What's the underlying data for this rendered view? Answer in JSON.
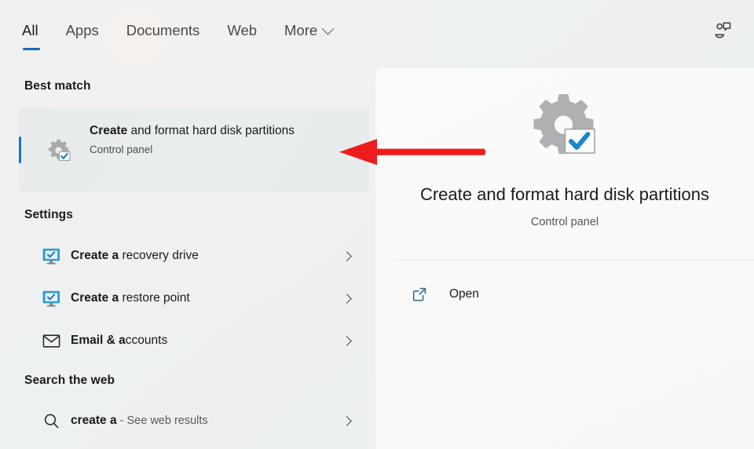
{
  "tabbar": {
    "tabs": [
      {
        "label": "All",
        "active": true
      },
      {
        "label": "Apps",
        "active": false
      },
      {
        "label": "Documents",
        "active": false
      },
      {
        "label": "Web",
        "active": false
      },
      {
        "label": "More",
        "active": false,
        "has_chevron": true
      }
    ],
    "feedback_icon": "feedback-person-speech-bubble-icon"
  },
  "left_panel": {
    "best_match": {
      "heading": "Best match",
      "title_bold": "Create",
      "title_rest": " and format hard disk partitions",
      "subtitle": "Control panel",
      "icon": "gear-with-checkbox-icon",
      "accent_color": "#1a6fc4",
      "selected": true
    },
    "settings": {
      "heading": "Settings",
      "items": [
        {
          "label_bold": "Create a",
          "label_rest": " recovery drive",
          "icon": "monitor-check-icon",
          "chevron": "chevron-right-icon"
        },
        {
          "label_bold": "Create a",
          "label_rest": " restore point",
          "icon": "monitor-check-icon",
          "chevron": "chevron-right-icon"
        },
        {
          "label_bold": "Email & a",
          "label_rest": "ccounts",
          "icon": "envelope-icon",
          "chevron": "chevron-right-icon"
        }
      ]
    },
    "search_web": {
      "heading": "Search the web",
      "items": [
        {
          "query_bold": "create a",
          "suffix": " - See web results",
          "icon": "search-icon",
          "chevron": "chevron-right-icon"
        }
      ]
    }
  },
  "preview_panel": {
    "icon": "gear-with-checkbox-large-icon",
    "title": "Create and format hard disk partitions",
    "subtitle": "Control panel",
    "actions": [
      {
        "label": "Open",
        "icon": "open-external-link-icon"
      }
    ]
  },
  "annotation": {
    "arrow": {
      "name": "red-arrow-pointing-to-best-match",
      "color": "#ee1c1c",
      "direction": "left"
    }
  }
}
